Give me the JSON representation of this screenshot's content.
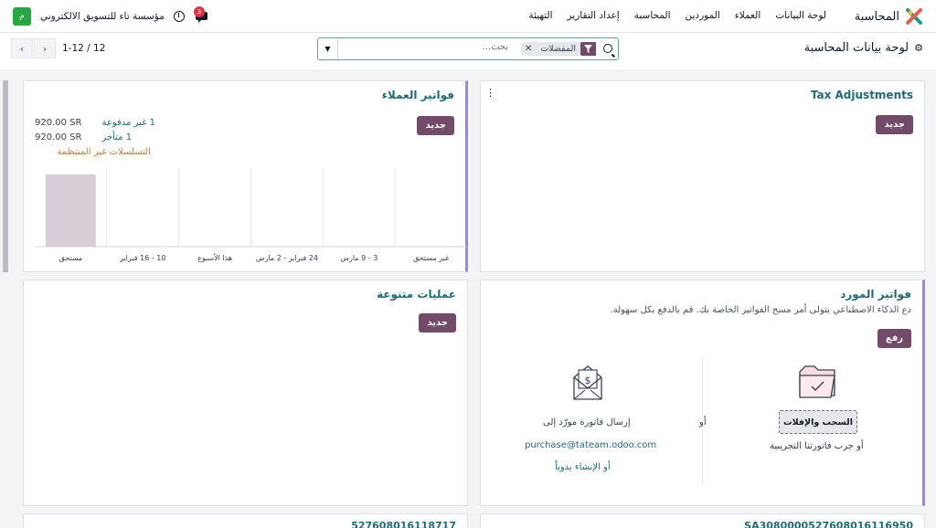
{
  "navbar": {
    "brand": "المحاسبة",
    "menu": [
      "لوحة البيانات",
      "العملاء",
      "الموردين",
      "المحاسبة",
      "إعداد التقارير",
      "التهيئة"
    ],
    "company": "مؤسسة تاء للتسويق الالكتروني",
    "company_initial": "م",
    "chat_badge": "3"
  },
  "control": {
    "title": "لوحة بيانات المحاسبة",
    "search_placeholder": "بحث...",
    "facet": "المفضلات",
    "pager": "1-12 / 12"
  },
  "cards": {
    "tax": {
      "title": "Tax Adjustments",
      "new": "جديد"
    },
    "customer": {
      "title": "فواتير العملاء",
      "new": "جديد",
      "stats": [
        {
          "label": "1 غير مدفوعة",
          "amount": "920.00 SR"
        },
        {
          "label": "1 متأخر",
          "amount": "920.00 SR"
        }
      ],
      "irregular": "التسلسلات غير المنتظمة"
    },
    "vendor": {
      "title": "فواتير المورد",
      "subtitle": "دع الذكاء الاصطناعي يتولى أمر مسح الفواتير الخاصة بك. قم بالدفع بكل سهولة.",
      "upload": "رفع",
      "drag_drop": "السحب والإفلات",
      "or": "أو",
      "try_sample": "أو جرب فاتورتنا التجريبية",
      "send_bill": "إرسال فاتورة مورّد إلى",
      "email": "purchase@tateam.odoo.com",
      "create_manual": "أو الإنشاء يدوياً"
    },
    "misc": {
      "title": "عمليات متنوعة",
      "new": "جديد"
    },
    "bottom": {
      "left_title": "527608016118717",
      "right_title": "SA3080000527608016116950"
    }
  },
  "chart_data": {
    "type": "bar",
    "categories": [
      "مستحق",
      "10 - 16 فبراير",
      "هذا الأسبوع",
      "24 فبراير - 2 مارس",
      "3 - 9 مارس",
      "غير مستحق"
    ],
    "values": [
      920,
      0,
      0,
      0,
      0,
      0
    ],
    "ylim": [
      0,
      1000
    ],
    "grid": true,
    "colors": {
      "bar": "#d8ccd6"
    }
  }
}
